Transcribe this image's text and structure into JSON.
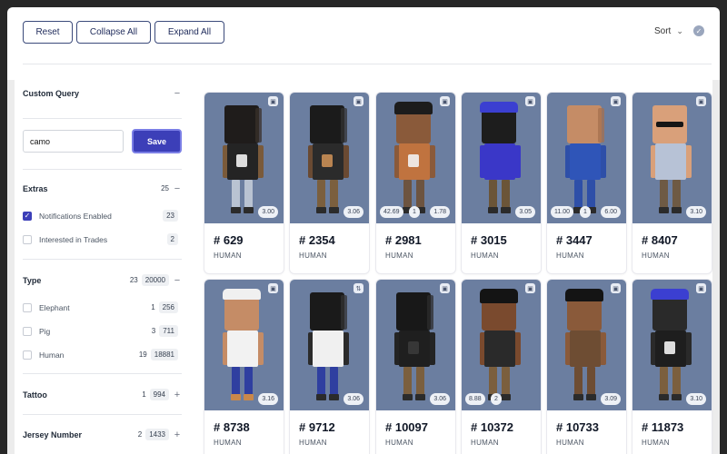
{
  "toolbar": {
    "reset_label": "Reset",
    "collapse_label": "Collapse All",
    "expand_label": "Expand All",
    "sort_label": "Sort"
  },
  "filters": {
    "custom_query": {
      "title": "Custom Query",
      "toggle": "−",
      "input_value": "camo",
      "save_label": "Save"
    },
    "extras": {
      "title": "Extras",
      "count": "25",
      "toggle": "−",
      "options": [
        {
          "label": "Notifications Enabled",
          "count": "23",
          "checked": true
        },
        {
          "label": "Interested in Trades",
          "count": "2",
          "checked": false
        }
      ]
    },
    "type": {
      "title": "Type",
      "count": "23",
      "total": "20000",
      "toggle": "−",
      "options": [
        {
          "label": "Elephant",
          "count": "1",
          "total": "256"
        },
        {
          "label": "Pig",
          "count": "3",
          "total": "711"
        },
        {
          "label": "Human",
          "count": "19",
          "total": "18881"
        }
      ]
    },
    "tattoo": {
      "title": "Tattoo",
      "count": "1",
      "total": "994",
      "toggle": "+"
    },
    "jersey": {
      "title": "Jersey Number",
      "count": "2",
      "total": "1433",
      "toggle": "+"
    }
  },
  "cards": [
    {
      "number": "# 629",
      "kind": "HUMAN",
      "chips": [
        "3.00"
      ]
    },
    {
      "number": "# 2354",
      "kind": "HUMAN",
      "chips": [
        "3.06"
      ]
    },
    {
      "number": "# 2981",
      "kind": "HUMAN",
      "chips": [
        "42.69",
        "1",
        "1.78"
      ]
    },
    {
      "number": "# 3015",
      "kind": "HUMAN",
      "chips": [
        "3.05"
      ]
    },
    {
      "number": "# 3447",
      "kind": "HUMAN",
      "chips": [
        "11.00",
        "1",
        "6.00"
      ]
    },
    {
      "number": "# 8407",
      "kind": "HUMAN",
      "chips": [
        "3.10"
      ]
    },
    {
      "number": "# 8738",
      "kind": "HUMAN",
      "chips": [
        "3.16"
      ]
    },
    {
      "number": "# 9712",
      "kind": "HUMAN",
      "chips": [
        "3.06"
      ]
    },
    {
      "number": "# 10097",
      "kind": "HUMAN",
      "chips": [
        "3.06"
      ]
    },
    {
      "number": "# 10372",
      "kind": "HUMAN",
      "chips": [
        "8.88",
        "2"
      ]
    },
    {
      "number": "# 10733",
      "kind": "HUMAN",
      "chips": [
        "3.09"
      ]
    },
    {
      "number": "# 11873",
      "kind": "HUMAN",
      "chips": [
        "3.10"
      ]
    }
  ],
  "icons": {
    "card_corner": "wallet-icon",
    "card_corner_alt": "swap-icon",
    "sort": "verified-icon"
  },
  "colors": {
    "accent": "#3c3fb8",
    "card_bg": "#6b7ea0"
  }
}
